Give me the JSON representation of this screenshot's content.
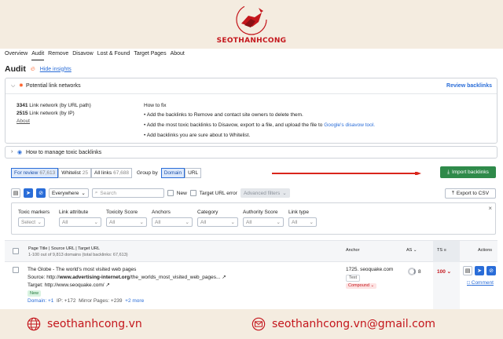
{
  "brand": {
    "name_prefix": "SEO",
    "name_rest": "THANHCONG"
  },
  "nav": {
    "tabs": [
      "Overview",
      "Audit",
      "Remove",
      "Disavow",
      "Lost & Found",
      "Target Pages",
      "About"
    ],
    "active": "Audit"
  },
  "page": {
    "title": "Audit",
    "hide_insights": "Hide insights"
  },
  "panel": {
    "title": "Potential link networks",
    "review_link": "Review backlinks",
    "stats": [
      {
        "value": "3341",
        "label": "Link network (by URL path)"
      },
      {
        "value": "2515",
        "label": "Link network (by IP)"
      }
    ],
    "about": "About",
    "howto_title": "How to fix",
    "howto": [
      "Add the backlinks to Remove and contact site owners to delete them.",
      "Add the most toxic backlinks to Disavow, export to a file, and upload the file to",
      "Add backlinks you are sure about to Whitelist."
    ],
    "disavow_tool_link": "Google's disavow tool."
  },
  "manage": {
    "label": "How to manage toxic backlinks"
  },
  "tabs": {
    "for_review": {
      "label": "For review",
      "count": "67,613"
    },
    "whitelist": {
      "label": "Whitelist",
      "count": "25"
    },
    "all_links": {
      "label": "All links",
      "count": "67,688"
    },
    "group_by": "Group by",
    "domain": "Domain",
    "url": "URL"
  },
  "import_button": "Import backlinks",
  "toolbar": {
    "scope": "Everywhere",
    "search_placeholder": "Search",
    "new_label": "New",
    "target_error": "Target URL error",
    "advanced": "Advanced filters",
    "export": "Export to CSV"
  },
  "filters": [
    {
      "label": "Toxic markers",
      "value": "Select"
    },
    {
      "label": "Link attribute",
      "value": "All"
    },
    {
      "label": "Toxicity Score",
      "value": "All"
    },
    {
      "label": "Anchors",
      "value": "All"
    },
    {
      "label": "Category",
      "value": "All"
    },
    {
      "label": "Authority Score",
      "value": "All"
    },
    {
      "label": "Link type",
      "value": "All"
    }
  ],
  "table": {
    "header_title": "Page Title | Source URL | Target URL",
    "header_sub": "1-100 out of 9,813 domains (total backlinks: 67,613)",
    "col_anchor": "Anchor",
    "col_as": "AS",
    "col_ts": "TS",
    "col_actions": "Actions"
  },
  "row": {
    "title": "The Globe - The world's most visited web pages",
    "source_prefix": "Source: http://",
    "source_bold": "www.advertising-internet.org",
    "source_rest": "/the_worlds_most_visited_web_pages...",
    "target": "Target: http://www.seoquake.com/",
    "badge": "New",
    "domain": "Domain: +1",
    "ip": "IP: +172",
    "mirror": "Mirror Pages: +239",
    "more": "+2 more",
    "anchor": "1725. seoquake.com",
    "anchor_tag": "Text",
    "anchor_type": "Compound",
    "as_value": "8",
    "ts_value": "100",
    "comment": "Comment"
  },
  "footer": {
    "site": "seothanhcong.vn",
    "email": "seothanhcong.vn@gmail.com"
  },
  "colors": {
    "brand_red": "#c4161c",
    "accent_blue": "#2a6dd8",
    "import_green": "#2f8a4a"
  }
}
